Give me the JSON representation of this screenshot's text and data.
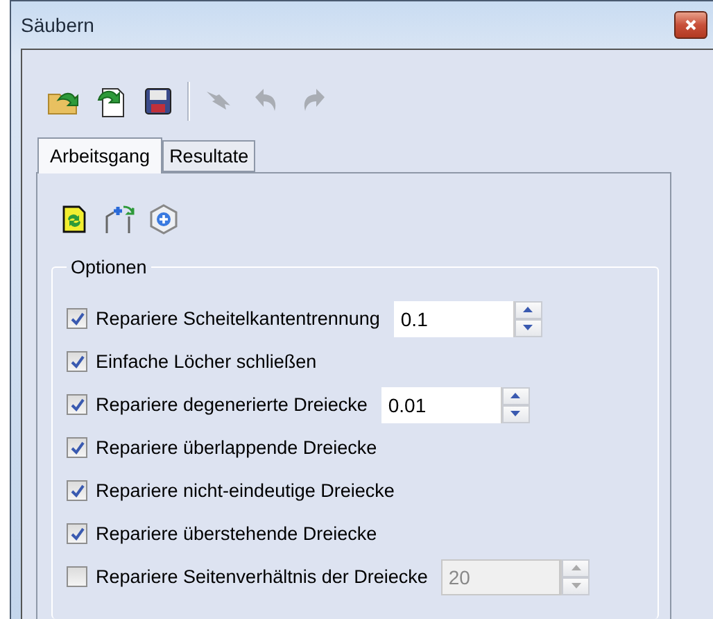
{
  "window": {
    "title": "Säubern"
  },
  "toolbar": [
    {
      "kind": "open",
      "disabled": false
    },
    {
      "kind": "reload",
      "disabled": false
    },
    {
      "kind": "save",
      "disabled": false
    },
    {
      "kind": "separator"
    },
    {
      "kind": "undo-all",
      "disabled": true
    },
    {
      "kind": "undo",
      "disabled": true
    },
    {
      "kind": "redo",
      "disabled": true
    }
  ],
  "tabs": [
    {
      "label": "Arbeitsgang",
      "selected": true
    },
    {
      "label": "Resultate",
      "selected": false
    }
  ],
  "panel_toolbar": [
    {
      "kind": "refresh"
    },
    {
      "kind": "add-vertex"
    },
    {
      "kind": "add"
    }
  ],
  "options_group": {
    "title": "Optionen",
    "items": [
      {
        "label": "Repariere Scheitelkantentrennung",
        "checked": true,
        "field": {
          "value": "0.1",
          "disabled": false
        }
      },
      {
        "label": "Einfache Löcher schließen",
        "checked": true
      },
      {
        "label": "Repariere degenerierte Dreiecke",
        "checked": true,
        "field": {
          "value": "0.01",
          "disabled": false
        }
      },
      {
        "label": "Repariere überlappende Dreiecke",
        "checked": true
      },
      {
        "label": "Repariere nicht-eindeutige Dreiecke",
        "checked": true
      },
      {
        "label": "Repariere überstehende Dreiecke",
        "checked": true
      },
      {
        "label": "Repariere Seitenverhältnis der Dreiecke",
        "checked": false,
        "field": {
          "value": "20",
          "disabled": true
        }
      }
    ]
  }
}
